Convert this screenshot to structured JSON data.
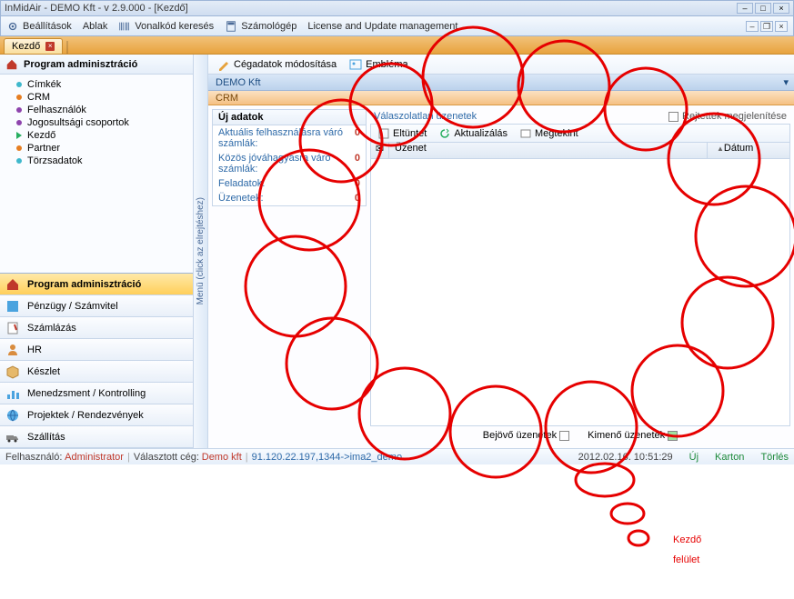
{
  "window": {
    "title": "InMidAir - DEMO Kft - v 2.9.000 - [Kezdő]"
  },
  "menu": {
    "beallitasok": "Beállítások",
    "ablak": "Ablak",
    "vonalkod": "Vonalkód keresés",
    "szamologep": "Számológép",
    "license": "License and Update management"
  },
  "tab": {
    "kezdo": "Kezdő"
  },
  "sidebar": {
    "header": "Program adminisztráció",
    "tree": {
      "cimkek": "Címkék",
      "crm": "CRM",
      "felhasznalok": "Felhasználók",
      "jogosultsagi": "Jogosultsági csoportok",
      "kezdo": "Kezdő",
      "partner": "Partner",
      "torzsadatok": "Törzsadatok"
    },
    "nav": {
      "program": "Program adminisztráció",
      "penzugy": "Pénzügy / Számvitel",
      "szamlazas": "Számlázás",
      "hr": "HR",
      "keszlet": "Készlet",
      "menedzsment": "Menedzsment / Kontrolling",
      "projektek": "Projektek / Rendezvények",
      "szallitas": "Szállítás"
    }
  },
  "vstrip": "Menü (click az elrejtéshez)",
  "toolbar": {
    "cegadatok": "Cégadatok módosítása",
    "emblema": "Embléma"
  },
  "blueband": "DEMO Kft",
  "orangeband": "CRM",
  "newdata": {
    "header": "Új adatok",
    "row1": "Aktuális felhasználásra váró számlák:",
    "row2": "Közös jóváhagyásra váró számlák:",
    "row3": "Feladatok:",
    "row4": "Üzenetek:",
    "v1": "0",
    "v2": "0",
    "v3": "0",
    "v4": "0"
  },
  "messages": {
    "title": "Válaszolatlan üzenetek",
    "hide": "Rejtettek megjelenítése",
    "eltuntet": "Eltüntet",
    "aktualizalas": "Aktualizálás",
    "megtekint": "Megtekint",
    "col_msg": "Üzenet",
    "col_date": "Dátum",
    "incoming": "Bejövő üzenetek",
    "outgoing": "Kimenő üzenetek"
  },
  "status": {
    "user_label": "Felhasználó:",
    "user": "Administrator",
    "company_label": "Választott cég:",
    "company": "Demo kft",
    "conn": "91.120.22.197,1344->ima2_demo",
    "date": "2012.02.16. 10:51:29",
    "uj": "Új",
    "karton": "Karton",
    "torles": "Törlés"
  },
  "annotation": {
    "line1": "Kezdő",
    "line2": "felület"
  }
}
